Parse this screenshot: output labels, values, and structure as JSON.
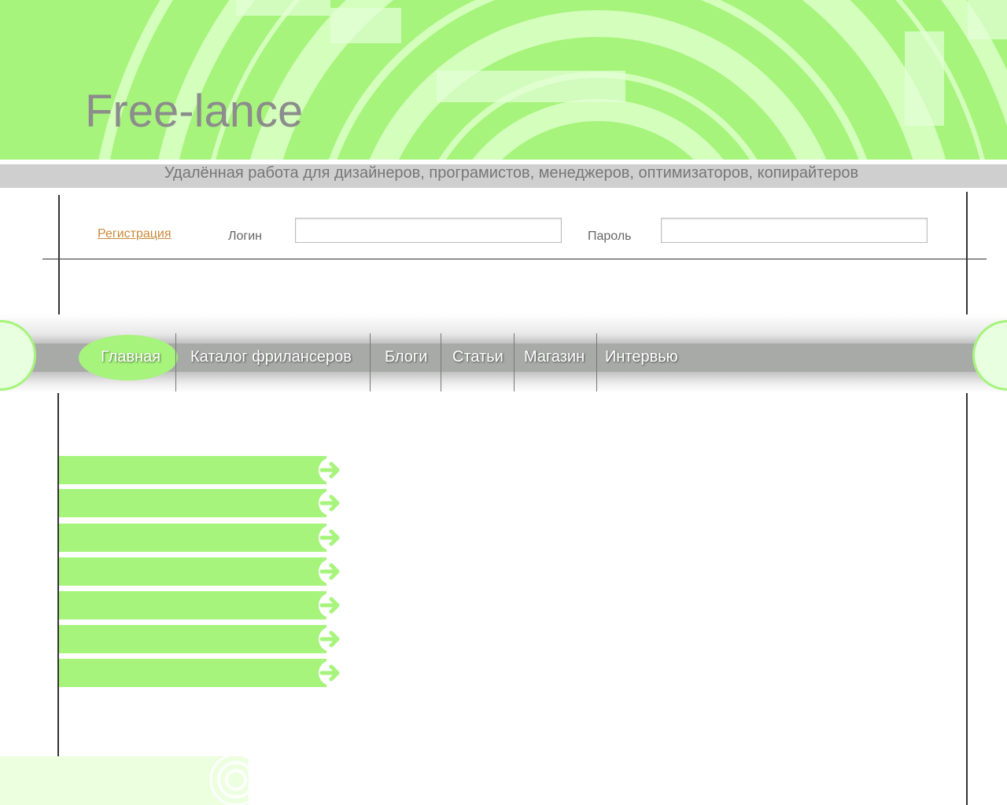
{
  "header": {
    "site_title": "Free-lance",
    "tagline": "Удалённая работа для дизайнеров, програмистов, менеджеров, оптимизаторов, копирайтеров"
  },
  "login": {
    "register_link": "Регистрация",
    "login_label": "Логин",
    "login_value": "",
    "password_label": "Пароль",
    "password_value": ""
  },
  "nav": {
    "items": [
      {
        "label": "Главная",
        "active": true
      },
      {
        "label": "Каталог фрилансеров",
        "active": false
      },
      {
        "label": "Блоги",
        "active": false
      },
      {
        "label": "Статьи",
        "active": false
      },
      {
        "label": "Магазин",
        "active": false
      },
      {
        "label": "Интервью",
        "active": false
      }
    ]
  },
  "side_menu": {
    "items": [
      {
        "label": "",
        "icon": "arrow-right-icon"
      },
      {
        "label": "",
        "icon": "arrow-right-icon"
      },
      {
        "label": "",
        "icon": "arrow-right-icon"
      },
      {
        "label": "",
        "icon": "arrow-right-icon"
      },
      {
        "label": "",
        "icon": "arrow-right-icon"
      },
      {
        "label": "",
        "icon": "arrow-right-icon"
      },
      {
        "label": "",
        "icon": "arrow-right-icon"
      }
    ]
  },
  "colors": {
    "accent_green": "#a6f47c",
    "light_green": "#ecffdf",
    "nav_gray": "#a8aaa8",
    "link_orange": "#c98a3a"
  }
}
